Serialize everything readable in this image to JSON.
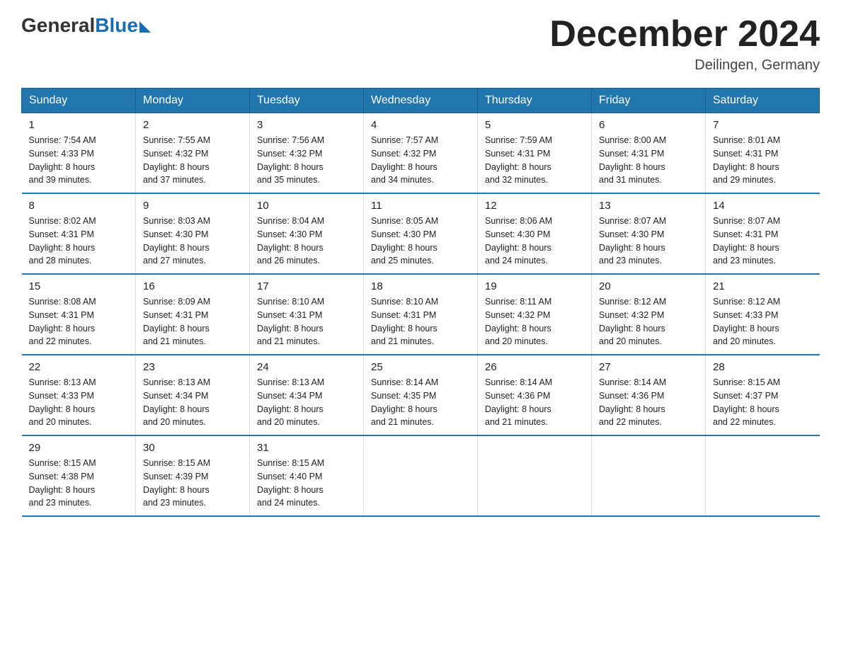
{
  "header": {
    "logo_general": "General",
    "logo_blue": "Blue",
    "month_title": "December 2024",
    "location": "Deilingen, Germany"
  },
  "days_of_week": [
    "Sunday",
    "Monday",
    "Tuesday",
    "Wednesday",
    "Thursday",
    "Friday",
    "Saturday"
  ],
  "weeks": [
    [
      {
        "day": "1",
        "sunrise": "7:54 AM",
        "sunset": "4:33 PM",
        "daylight": "8 hours and 39 minutes."
      },
      {
        "day": "2",
        "sunrise": "7:55 AM",
        "sunset": "4:32 PM",
        "daylight": "8 hours and 37 minutes."
      },
      {
        "day": "3",
        "sunrise": "7:56 AM",
        "sunset": "4:32 PM",
        "daylight": "8 hours and 35 minutes."
      },
      {
        "day": "4",
        "sunrise": "7:57 AM",
        "sunset": "4:32 PM",
        "daylight": "8 hours and 34 minutes."
      },
      {
        "day": "5",
        "sunrise": "7:59 AM",
        "sunset": "4:31 PM",
        "daylight": "8 hours and 32 minutes."
      },
      {
        "day": "6",
        "sunrise": "8:00 AM",
        "sunset": "4:31 PM",
        "daylight": "8 hours and 31 minutes."
      },
      {
        "day": "7",
        "sunrise": "8:01 AM",
        "sunset": "4:31 PM",
        "daylight": "8 hours and 29 minutes."
      }
    ],
    [
      {
        "day": "8",
        "sunrise": "8:02 AM",
        "sunset": "4:31 PM",
        "daylight": "8 hours and 28 minutes."
      },
      {
        "day": "9",
        "sunrise": "8:03 AM",
        "sunset": "4:30 PM",
        "daylight": "8 hours and 27 minutes."
      },
      {
        "day": "10",
        "sunrise": "8:04 AM",
        "sunset": "4:30 PM",
        "daylight": "8 hours and 26 minutes."
      },
      {
        "day": "11",
        "sunrise": "8:05 AM",
        "sunset": "4:30 PM",
        "daylight": "8 hours and 25 minutes."
      },
      {
        "day": "12",
        "sunrise": "8:06 AM",
        "sunset": "4:30 PM",
        "daylight": "8 hours and 24 minutes."
      },
      {
        "day": "13",
        "sunrise": "8:07 AM",
        "sunset": "4:30 PM",
        "daylight": "8 hours and 23 minutes."
      },
      {
        "day": "14",
        "sunrise": "8:07 AM",
        "sunset": "4:31 PM",
        "daylight": "8 hours and 23 minutes."
      }
    ],
    [
      {
        "day": "15",
        "sunrise": "8:08 AM",
        "sunset": "4:31 PM",
        "daylight": "8 hours and 22 minutes."
      },
      {
        "day": "16",
        "sunrise": "8:09 AM",
        "sunset": "4:31 PM",
        "daylight": "8 hours and 21 minutes."
      },
      {
        "day": "17",
        "sunrise": "8:10 AM",
        "sunset": "4:31 PM",
        "daylight": "8 hours and 21 minutes."
      },
      {
        "day": "18",
        "sunrise": "8:10 AM",
        "sunset": "4:31 PM",
        "daylight": "8 hours and 21 minutes."
      },
      {
        "day": "19",
        "sunrise": "8:11 AM",
        "sunset": "4:32 PM",
        "daylight": "8 hours and 20 minutes."
      },
      {
        "day": "20",
        "sunrise": "8:12 AM",
        "sunset": "4:32 PM",
        "daylight": "8 hours and 20 minutes."
      },
      {
        "day": "21",
        "sunrise": "8:12 AM",
        "sunset": "4:33 PM",
        "daylight": "8 hours and 20 minutes."
      }
    ],
    [
      {
        "day": "22",
        "sunrise": "8:13 AM",
        "sunset": "4:33 PM",
        "daylight": "8 hours and 20 minutes."
      },
      {
        "day": "23",
        "sunrise": "8:13 AM",
        "sunset": "4:34 PM",
        "daylight": "8 hours and 20 minutes."
      },
      {
        "day": "24",
        "sunrise": "8:13 AM",
        "sunset": "4:34 PM",
        "daylight": "8 hours and 20 minutes."
      },
      {
        "day": "25",
        "sunrise": "8:14 AM",
        "sunset": "4:35 PM",
        "daylight": "8 hours and 21 minutes."
      },
      {
        "day": "26",
        "sunrise": "8:14 AM",
        "sunset": "4:36 PM",
        "daylight": "8 hours and 21 minutes."
      },
      {
        "day": "27",
        "sunrise": "8:14 AM",
        "sunset": "4:36 PM",
        "daylight": "8 hours and 22 minutes."
      },
      {
        "day": "28",
        "sunrise": "8:15 AM",
        "sunset": "4:37 PM",
        "daylight": "8 hours and 22 minutes."
      }
    ],
    [
      {
        "day": "29",
        "sunrise": "8:15 AM",
        "sunset": "4:38 PM",
        "daylight": "8 hours and 23 minutes."
      },
      {
        "day": "30",
        "sunrise": "8:15 AM",
        "sunset": "4:39 PM",
        "daylight": "8 hours and 23 minutes."
      },
      {
        "day": "31",
        "sunrise": "8:15 AM",
        "sunset": "4:40 PM",
        "daylight": "8 hours and 24 minutes."
      },
      null,
      null,
      null,
      null
    ]
  ],
  "labels": {
    "sunrise": "Sunrise:",
    "sunset": "Sunset:",
    "daylight": "Daylight:"
  }
}
